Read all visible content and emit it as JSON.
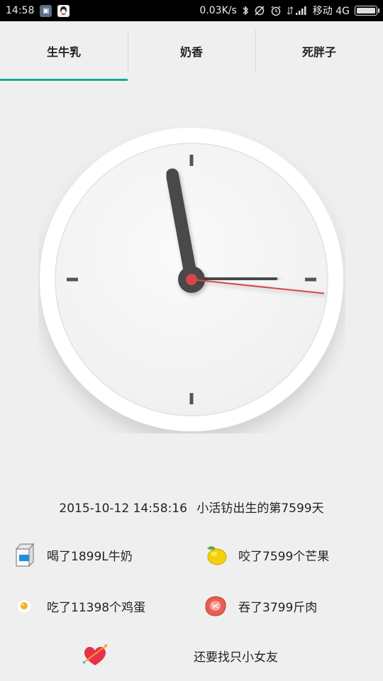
{
  "status_bar": {
    "time": "14:58",
    "network_speed": "0.03K/s",
    "carrier": "移动 4G",
    "icons": [
      "image-icon",
      "qq-icon",
      "bluetooth-icon",
      "sync-off-icon",
      "alarm-icon",
      "signal-icon",
      "battery-icon"
    ]
  },
  "tabs": [
    {
      "label": "生牛乳",
      "active": true
    },
    {
      "label": "奶香",
      "active": false
    },
    {
      "label": "死胖子",
      "active": false
    }
  ],
  "clock": {
    "hour": 14,
    "minute": 58,
    "second": 16,
    "colors": {
      "hand": "#4a4a4a",
      "second_hand": "#d9454a",
      "center": "#d9454a"
    }
  },
  "info": {
    "datetime": "2015-10-12 14:58:16",
    "birth_text": "小活钫出生的第7599天"
  },
  "stats": [
    {
      "icon": "milk-carton-icon",
      "text": "喝了1899L牛奶"
    },
    {
      "icon": "mango-icon",
      "text": "咬了7599个芒果"
    },
    {
      "icon": "egg-icon",
      "text": "吃了11398个鸡蛋"
    },
    {
      "icon": "meat-icon",
      "text": "吞了3799斤肉"
    }
  ],
  "girlfriend": {
    "icon": "heart-arrow-icon",
    "text": "还要找只小女友"
  },
  "accent": "#1aa894"
}
